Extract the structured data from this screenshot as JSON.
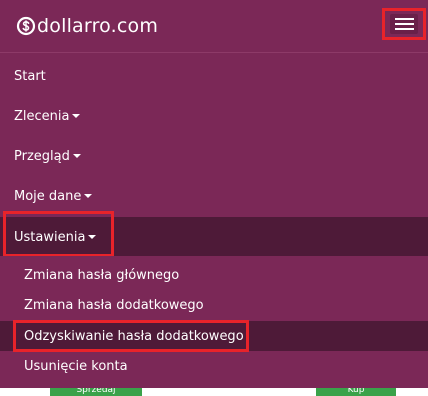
{
  "app": {
    "brand": "dollarro.com",
    "logo_icon": "dollar-circle-icon",
    "accent_color": "#7b2857",
    "highlight_color": "#e8232a"
  },
  "nav": {
    "items": [
      {
        "label": "Start",
        "has_caret": false
      },
      {
        "label": "Zlecenia",
        "has_caret": true
      },
      {
        "label": "Przegląd",
        "has_caret": true
      },
      {
        "label": "Moje dane",
        "has_caret": true
      },
      {
        "label": "Ustawienia",
        "has_caret": true,
        "expanded": true
      }
    ],
    "settings_submenu": [
      {
        "label": "Zmiana hasła głównego"
      },
      {
        "label": "Zmiana hasła dodatkowego"
      },
      {
        "label": "Odzyskiwanie hasła dodatkowego",
        "highlighted": true
      },
      {
        "label": "Usunięcie konta"
      }
    ]
  },
  "background_buttons": {
    "sell_label": "Sprzedaj",
    "buy_label": "Kup"
  }
}
